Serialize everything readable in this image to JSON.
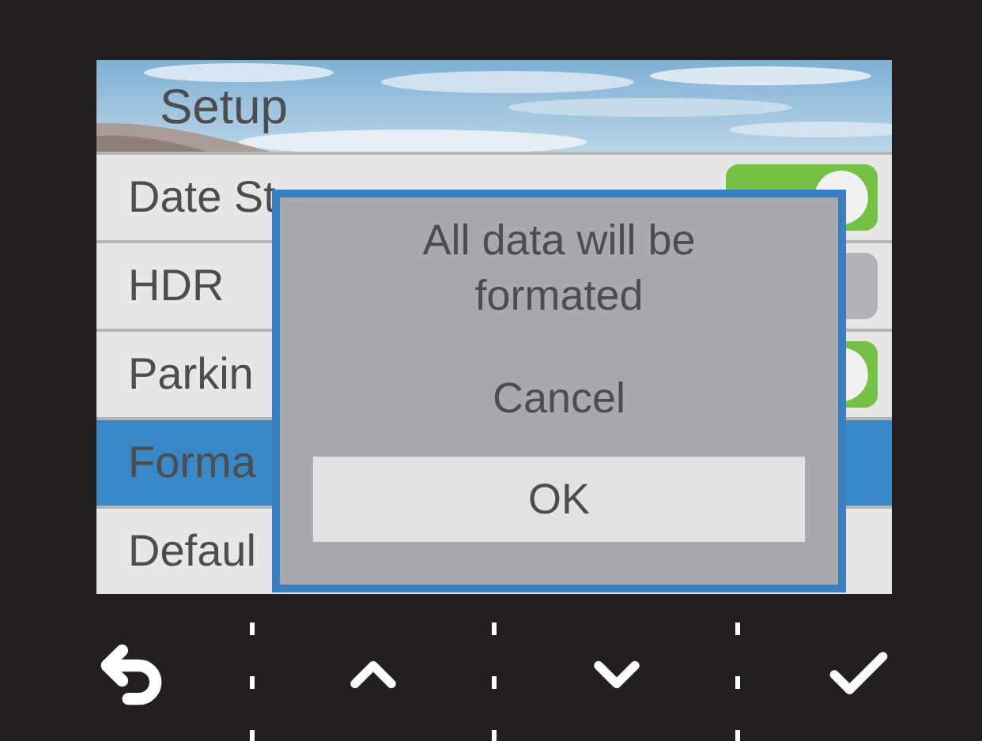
{
  "screen": {
    "title": "Setup",
    "items": [
      {
        "label": "Date St",
        "kind": "toggle",
        "on": true,
        "selected": false
      },
      {
        "label": "HDR",
        "kind": "toggle",
        "on": false,
        "selected": false
      },
      {
        "label": "Parkin",
        "kind": "toggle",
        "on": true,
        "selected": false
      },
      {
        "label": "Forma",
        "kind": "action",
        "selected": true
      },
      {
        "label": "Defaul",
        "kind": "action",
        "selected": false
      }
    ]
  },
  "dialog": {
    "message": "All data will be formated",
    "options": [
      {
        "label": "Cancel",
        "selected": false
      },
      {
        "label": "OK",
        "selected": true
      }
    ]
  },
  "buttons": [
    {
      "kind": "back"
    },
    {
      "kind": "up"
    },
    {
      "kind": "down"
    },
    {
      "kind": "confirm"
    }
  ]
}
